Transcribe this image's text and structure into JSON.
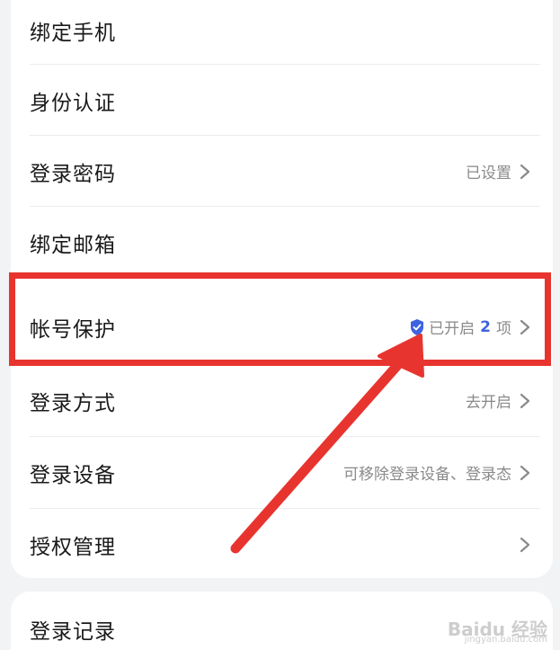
{
  "settings": {
    "items": [
      {
        "label": "绑定手机",
        "value": ""
      },
      {
        "label": "身份认证",
        "value": ""
      },
      {
        "label": "登录密码",
        "value": "已设置"
      },
      {
        "label": "绑定邮箱",
        "value": ""
      },
      {
        "label": "帐号保护",
        "value_prefix": "已开启",
        "count": "2",
        "value_suffix": "项"
      },
      {
        "label": "登录方式",
        "value": "去开启"
      },
      {
        "label": "登录设备",
        "value": "可移除登录设备、登录态"
      },
      {
        "label": "授权管理",
        "value": ""
      }
    ]
  },
  "second_card": {
    "items": [
      {
        "label": "登录记录"
      }
    ]
  },
  "watermark": {
    "text": "Baidu 经验",
    "sub": "jingyan.baidu.com"
  },
  "colors": {
    "accent": "#3d63e0",
    "highlight": "#e8342f",
    "background": "#f2f3f5"
  }
}
